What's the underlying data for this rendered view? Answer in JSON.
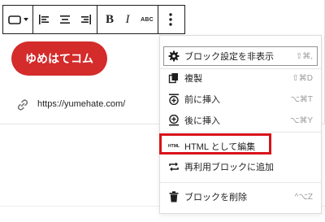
{
  "toolbar": {
    "icons": [
      "block-type-icon",
      "chevron-down-icon",
      "align-left-icon",
      "align-center-icon",
      "align-right-icon",
      "bold-icon",
      "italic-icon",
      "strikethrough-icon",
      "more-options-icon"
    ],
    "bold_label": "B",
    "italic_label": "I",
    "strikethrough_label": "ABC"
  },
  "block": {
    "button_text": "ゆめはてコム",
    "link_url": "https://yumehate.com/"
  },
  "menu": {
    "items": [
      {
        "icon": "gear-icon",
        "label": "ブロック設定を非表示",
        "shortcut": "⇧⌘,"
      },
      {
        "icon": "duplicate-icon",
        "label": "複製",
        "shortcut": "⇧⌘D"
      },
      {
        "icon": "insert-before-icon",
        "label": "前に挿入",
        "shortcut": "⌥⌘T"
      },
      {
        "icon": "insert-after-icon",
        "label": "後に挿入",
        "shortcut": "⌥⌘Y"
      },
      {
        "icon": "html-icon",
        "label": "HTML として編集",
        "shortcut": ""
      },
      {
        "icon": "reusable-block-icon",
        "label": "再利用ブロックに追加",
        "shortcut": ""
      },
      {
        "icon": "trash-icon",
        "label": "ブロックを削除",
        "shortcut": "^⌥Z"
      }
    ],
    "html_icon_text": "HTML"
  },
  "colors": {
    "button_bg": "#d42b2b",
    "highlight_border": "#d9121a"
  }
}
